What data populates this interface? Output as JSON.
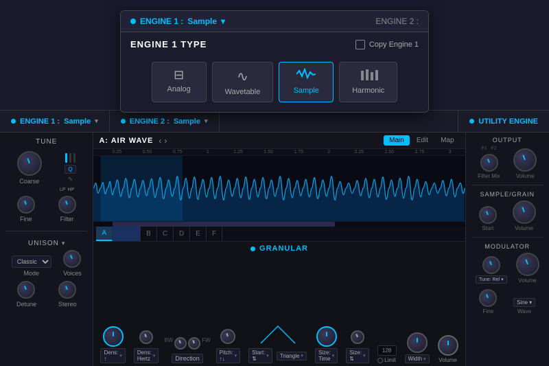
{
  "popup": {
    "engine1_label": "ENGINE 1 :",
    "engine1_type": "Sample",
    "engine1_dropdown": "▾",
    "engine2_label": "ENGINE 2 :",
    "title": "ENGINE 1 TYPE",
    "copy_label": "Copy Engine 1",
    "types": [
      {
        "id": "analog",
        "label": "Analog",
        "icon": "⊟"
      },
      {
        "id": "wavetable",
        "label": "Wavetable",
        "icon": "∿"
      },
      {
        "id": "sample",
        "label": "Sample",
        "icon": "≋",
        "active": true
      },
      {
        "id": "harmonic",
        "label": "Harmonic",
        "icon": "▐▐"
      }
    ]
  },
  "topbar": {
    "engine1_label": "ENGINE 1 :",
    "engine1_type": "Sample",
    "engine2_label": "ENGINE 2 :",
    "engine2_type": "Sample",
    "utility_label": "UTILITY ENGINE"
  },
  "left_panel": {
    "tune_title": "TUNE",
    "coarse_label": "Coarse",
    "fine_label": "Fine",
    "filter_label": "Filter",
    "lp_label": "LP",
    "hp_label": "HP",
    "unison_label": "UNISON",
    "unison_arrow": "▾",
    "mode_label": "Mode",
    "voices_label": "Voices",
    "detune_label": "Detune",
    "stereo_label": "Stereo",
    "mode_value": "Classic"
  },
  "waveform": {
    "name": "A: AIR WAVE",
    "nav_prev": "‹",
    "nav_next": "›",
    "tabs": [
      "Main",
      "Edit",
      "Map"
    ],
    "active_tab": "Main",
    "zones": [
      "A",
      "B",
      "C",
      "D",
      "E",
      "F"
    ],
    "active_zone": "A",
    "ruler_marks": [
      "0.25",
      "0.50",
      "0.75",
      "1",
      "1.25",
      "1.50",
      "1.75",
      "2",
      "2.25",
      "2.50",
      "2.75",
      "3"
    ]
  },
  "granular": {
    "title": "GRANULAR",
    "dens_knob_label": "Dens: ↑",
    "dens_dropdown": "▾",
    "dens_hz_label": "Dens: Hertz",
    "dens_hz_dropdown": "▾",
    "size_time_label": "Size: Time",
    "size_time_dropdown": "▾",
    "size_dropdown": "Size: ⇅",
    "size_arr": "▾",
    "bw_label": "BW",
    "fw_label": "FW",
    "direction_label": "Direction",
    "pitch_label": "Pitch: ↑↓",
    "pitch_dropdown": "▾",
    "start_label": "Start: ⇅",
    "start_dropdown": "▾",
    "shape_label": "Triangle",
    "shape_dropdown": "▾",
    "limit_label": "Limit",
    "limit_value": "128",
    "width_label": "Width",
    "width_dropdown": "▾",
    "volume_label": "Volume"
  },
  "output": {
    "title": "OUTPUT",
    "f1_label": "F1",
    "f2_label": "F2",
    "filter_mix_label": "Filter Mix",
    "volume_label": "Volume"
  },
  "sample_grain": {
    "title": "SAMPLE/GRAIN",
    "start_label": "Start",
    "volume_label": "Volume"
  },
  "modulator": {
    "title": "MODULATOR",
    "tune_rel_label": "Tune: Rel",
    "tune_dropdown": "▾",
    "volume_label": "Volume",
    "fine_label": "Fine",
    "wave_label": "Wave",
    "wave_value": "Sine",
    "wave_dropdown": "▾"
  },
  "colors": {
    "accent": "#00bfff",
    "bg_dark": "#111118",
    "bg_mid": "#14141e",
    "bg_panel": "#1a1a28",
    "border": "#2a2a3a",
    "text_dim": "#888888",
    "text_light": "#aaaaaa"
  }
}
